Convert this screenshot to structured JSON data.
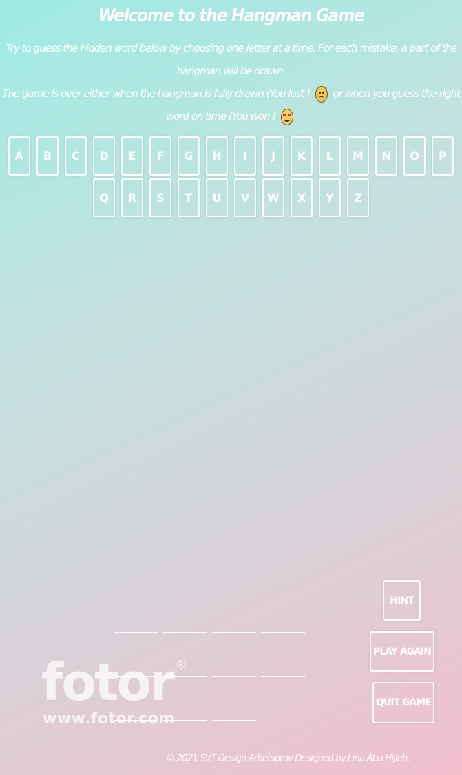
{
  "header": {
    "title": "Welcome to the Hangman Game",
    "instructions_line1": "Try to guess the hidden word below by choosing one letter at a time. For each mistake, a part of the hangman will be drawn.",
    "instructions_line2_a": "The game is over either when the hangman is fully drawn (You lost ! ",
    "instructions_line2_b": " or when you guess the right word on time (You won ! ",
    "instructions_line2_c": ""
  },
  "keyboard": {
    "letters": [
      "A",
      "B",
      "C",
      "D",
      "E",
      "F",
      "G",
      "H",
      "I",
      "J",
      "K",
      "L",
      "M",
      "N",
      "O",
      "P",
      "Q",
      "R",
      "S",
      "T",
      "U",
      "V",
      "W",
      "X",
      "Y",
      "Z"
    ]
  },
  "word": {
    "blank_rows": [
      4,
      4,
      3
    ]
  },
  "actions": {
    "hint_label": "HINT",
    "play_again_label": "PLAY AGAIN",
    "quit_label": "QUIT GAME"
  },
  "watermark": {
    "logo": "fotor",
    "registered": "®",
    "url": "www.fotor.com"
  },
  "footer": {
    "text": "© 2021 SVT Design Arbetsprov Designed by Lina Abu Hijleh."
  },
  "icons": {
    "sad": "sad-face-icon",
    "happy": "heart-eyes-face-icon"
  }
}
